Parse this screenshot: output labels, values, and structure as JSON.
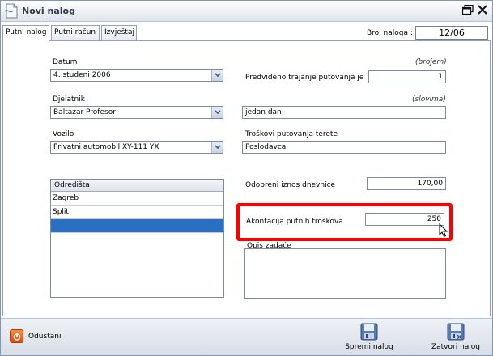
{
  "window": {
    "title": "Novi nalog"
  },
  "tabs": [
    {
      "label": "Putni nalog"
    },
    {
      "label": "Putni račun"
    },
    {
      "label": "Izvještaj"
    }
  ],
  "header": {
    "broj_label": "Broj naloga :",
    "broj_value": "12/06"
  },
  "form": {
    "datum": {
      "label": "Datum",
      "value": "4. studeni 2006"
    },
    "djelatnik": {
      "label": "Djelatnik",
      "value": "Baltazar Profesor"
    },
    "vozilo": {
      "label": "Vozilo",
      "value": "Privatni automobil XY-111 YX"
    },
    "trajanje": {
      "label": "Predviđeno trajanje putovanja je",
      "hint": "(brojem)",
      "value": "1"
    },
    "slovima": {
      "hint": "(slovima)",
      "value": "jedan dan"
    },
    "troskovi": {
      "label": "Troškovi putovanja terete",
      "value": "Poslodavca"
    },
    "dnevnice": {
      "label": "Odobreni iznos dnevnice",
      "value": "170,00"
    },
    "akontacija": {
      "label": "Akontacija putnih troškova",
      "value": "250"
    },
    "opis": {
      "label": "Opis zadaće",
      "value": ""
    }
  },
  "odredista": {
    "header": "Odredišta",
    "rows": [
      "Zagreb",
      "Split",
      ""
    ]
  },
  "buttons": {
    "odustani": "Odustani",
    "spremi": "Spremi nalog",
    "zatvori": "Zatvori nalog"
  },
  "colors": {
    "selection": "#2b6fc2",
    "highlight": "#ff0000",
    "cancel": "#e24a0a"
  }
}
